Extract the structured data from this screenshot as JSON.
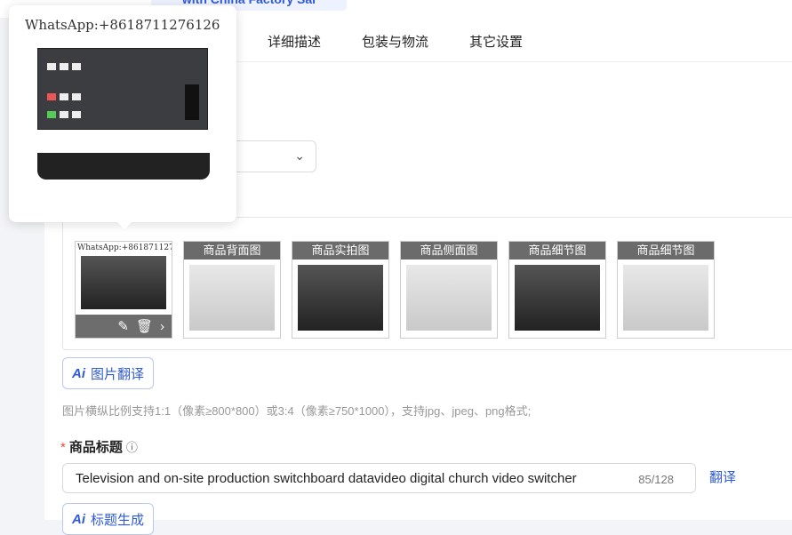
{
  "header": {
    "fragment": "with China Factory Sal"
  },
  "tabs": [
    {
      "label": "详细描述"
    },
    {
      "label": "包装与物流"
    },
    {
      "label": "其它设置"
    }
  ],
  "popup": {
    "watermark": "WhatsApp:+8618711276126"
  },
  "images": [
    {
      "caption": "",
      "watermark": "WhatsApp:+8618711276126"
    },
    {
      "caption": "商品背面图"
    },
    {
      "caption": "商品实拍图"
    },
    {
      "caption": "商品侧面图"
    },
    {
      "caption": "商品细节图"
    },
    {
      "caption": "商品细节图"
    }
  ],
  "image_translate": {
    "ai": "Ai",
    "label": "图片翻译"
  },
  "hint": "图片横纵比例支持1:1（像素≥800*800）或3:4（像素≥750*1000），支持jpg、jpeg、png格式;",
  "title_field": {
    "required": "*",
    "label": "商品标题",
    "help": "?",
    "value": "Television and on-site production switchboard datavideo digital church video switcher",
    "count": "85/128",
    "translate": "翻译"
  },
  "title_generate": {
    "ai": "Ai",
    "label": "标题生成"
  }
}
